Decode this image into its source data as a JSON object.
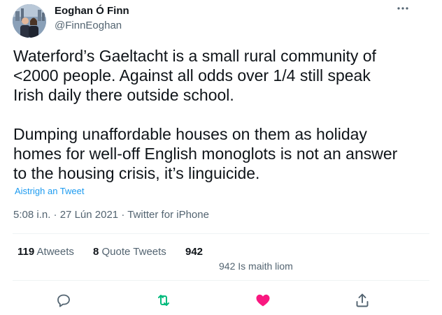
{
  "user": {
    "name": "Eoghan Ó Finn",
    "handle": "@FinnEoghan"
  },
  "tweet": {
    "text": "Waterford’s Gaeltacht is a small rural community of <2000 people. Against all odds over 1/4 still speak Irish daily there outside school.\n\nDumping unaffordable houses on them as holiday homes for well-off English monoglots is not an answer to the housing crisis, it’s linguicide.",
    "translate_link": "Aistrigh an Tweet",
    "time": "5:08 i.n.",
    "date": "27 Lún 2021",
    "source": "Twitter for iPhone",
    "separator": "·"
  },
  "stats": {
    "retweets_count": "119",
    "retweets_label": "Atweets",
    "quotes_count": "8",
    "quotes_label": "Quote Tweets",
    "likes_count": "942",
    "likes_label": "942 Is maith liom"
  },
  "icons": {
    "more": "more-horizontal-icon",
    "reply": "reply-icon",
    "retweet": "retweet-icon",
    "like": "heart-icon",
    "share": "share-icon"
  },
  "colors": {
    "link": "#1d9bf0",
    "retweet_green": "#00ba7c",
    "like_pink": "#f91880",
    "secondary_text": "#536471"
  }
}
